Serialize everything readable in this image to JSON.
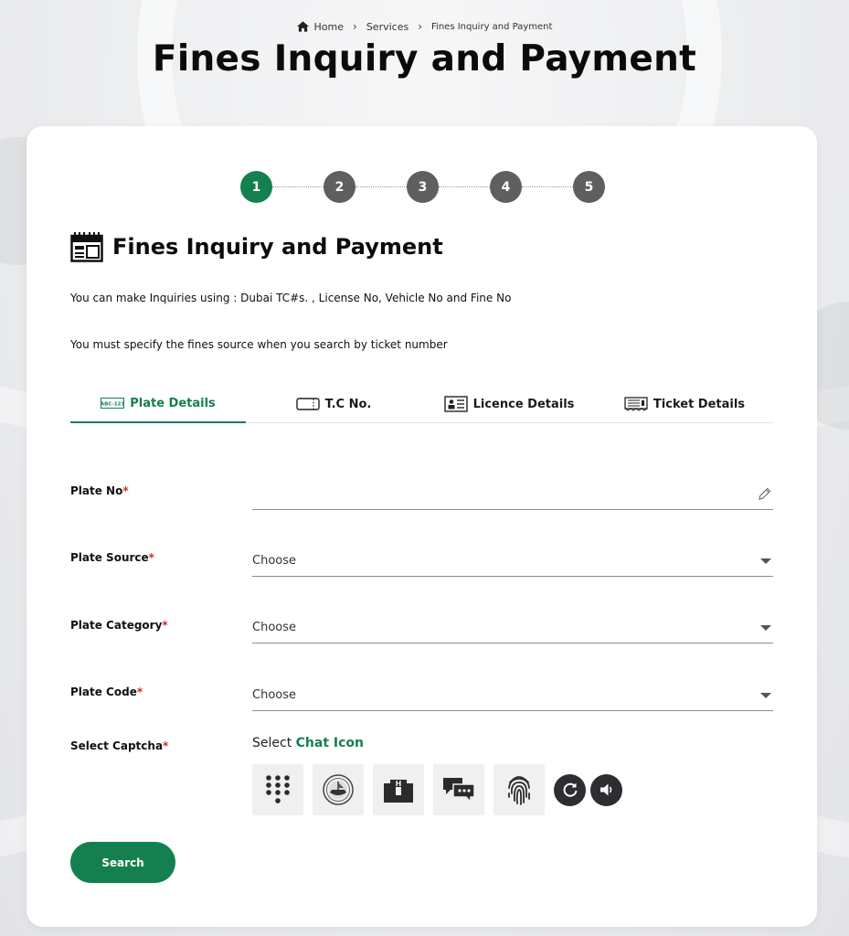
{
  "breadcrumb": {
    "home": "Home",
    "services": "Services",
    "current": "Fines Inquiry and Payment",
    "separator": "›"
  },
  "page_title": "Fines Inquiry and Payment",
  "stepper": {
    "steps": [
      "1",
      "2",
      "3",
      "4",
      "5"
    ],
    "active_step": 1
  },
  "section": {
    "title": "Fines Inquiry and Payment",
    "info_line_1": "You can make Inquiries using : Dubai TC#s. , License No, Vehicle No and Fine No",
    "info_line_2": "You must specify the fines source when you search by ticket number"
  },
  "tabs": [
    {
      "label": "Plate Details",
      "icon": "plate-icon",
      "active": true
    },
    {
      "label": "T.C No.",
      "icon": "card-icon",
      "active": false
    },
    {
      "label": "Licence Details",
      "icon": "licence-icon",
      "active": false
    },
    {
      "label": "Ticket Details",
      "icon": "ticket-icon",
      "active": false
    }
  ],
  "form": {
    "required_mark": "*",
    "plate_no": {
      "label": "Plate No",
      "value": ""
    },
    "plate_source": {
      "label": "Plate Source",
      "selected": "Choose"
    },
    "plate_category": {
      "label": "Plate Category",
      "selected": "Choose"
    },
    "plate_code": {
      "label": "Plate Code",
      "selected": "Choose"
    }
  },
  "captcha": {
    "label": "Select Captcha",
    "prompt_prefix": "Select",
    "prompt_target": "Chat Icon",
    "options": [
      "keypad-icon",
      "emblem-icon",
      "building-icon",
      "chat-icon",
      "fingerprint-icon"
    ],
    "refresh_icon": "refresh-icon",
    "audio_icon": "speaker-icon"
  },
  "search_button": "Search",
  "colors": {
    "accent": "#14804f",
    "step_inactive": "#5f5f5f",
    "required": "#d6262c"
  }
}
